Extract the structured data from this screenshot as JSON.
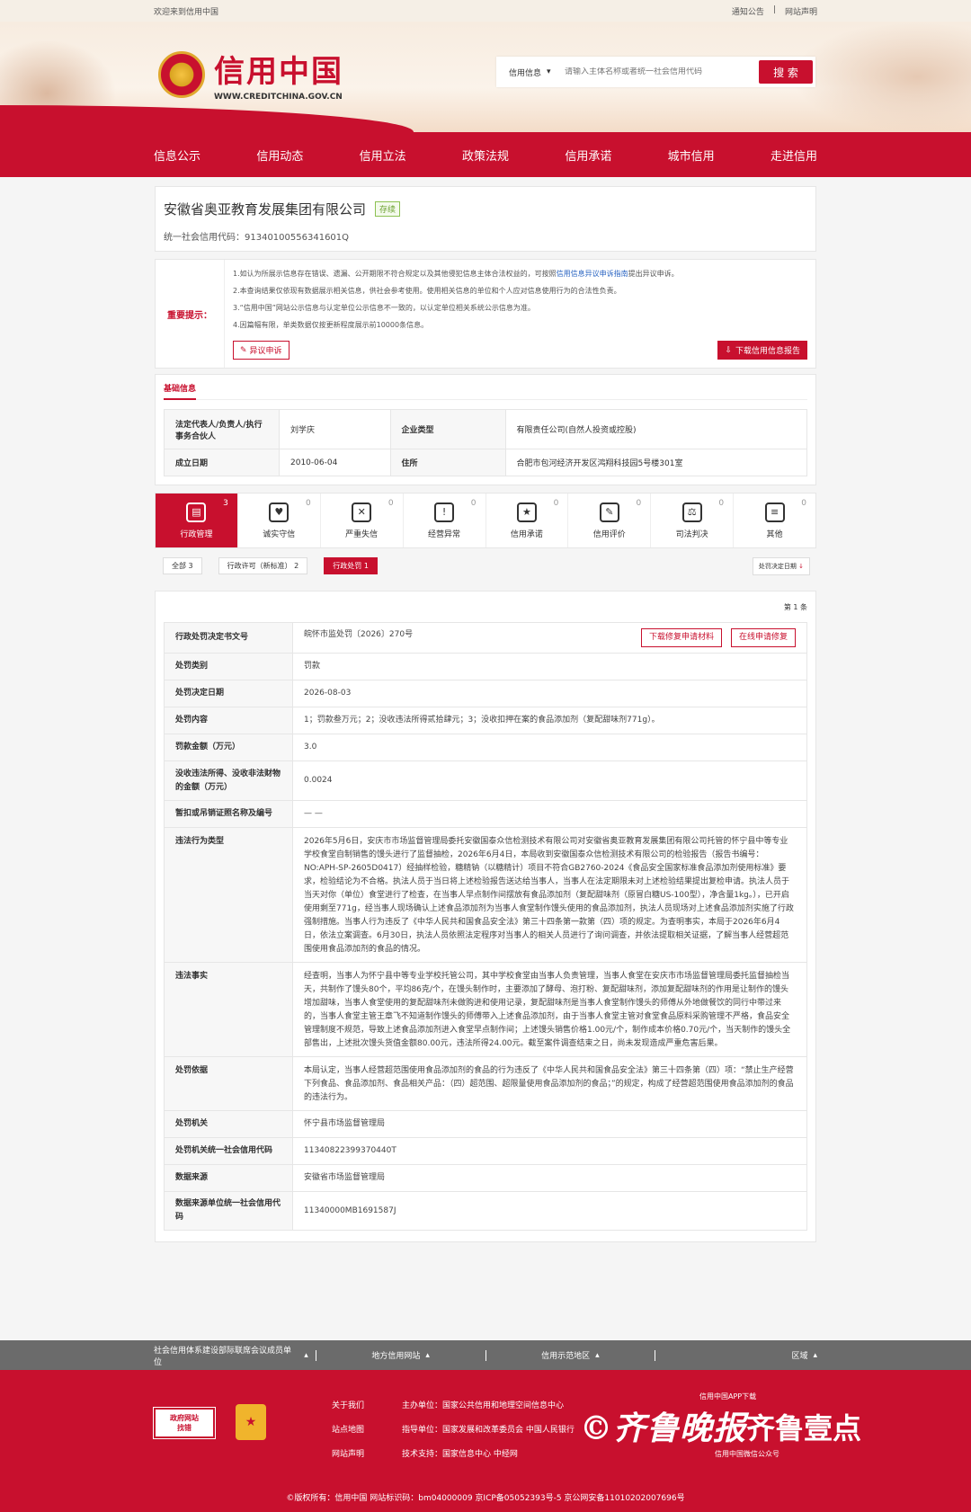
{
  "topbar": {
    "welcome": "欢迎来到信用中国",
    "notice": "通知公告",
    "sep": "|",
    "statement": "网站声明"
  },
  "header": {
    "title": "信用中国",
    "url": "WWW.CREDITCHINA.GOV.CN"
  },
  "search": {
    "select": "信用信息",
    "placeholder": "请输入主体名称或者统一社会信用代码",
    "button": "搜 索"
  },
  "nav": [
    "信息公示",
    "信用动态",
    "信用立法",
    "政策法规",
    "信用承诺",
    "城市信用",
    "走进信用"
  ],
  "company": {
    "name": "安徽省奥亚教育发展集团有限公司",
    "status": "存续",
    "code_label": "统一社会信用代码：",
    "code": "91340100556341601Q"
  },
  "notice": {
    "label": "重要提示：",
    "lines": [
      "1.如认为所展示信息存在错误、遗漏、公开期限不符合规定以及其他侵犯信息主体合法权益的，可按照",
      "2.本查询结果仅依现有数据展示相关信息，供社会参考使用。使用相关信息的单位和个人应对信息使用行为的合法性负责。",
      "3.“信用中国”网站公示信息与认定单位公示信息不一致的，以认定单位相关系统公示信息为准。",
      "4.因篇幅有限，单类数据仅按更新程度展示前10000条信息。"
    ],
    "line1_link": "信用信息异议申诉指南",
    "line1_tail": "提出异议申诉。",
    "objection": "异议申诉",
    "download": "下载信用信息报告"
  },
  "basic": {
    "title": "基础信息",
    "rows": [
      {
        "k1": "法定代表人/负责人/执行事务合伙人",
        "v1": "刘学庆",
        "k2": "企业类型",
        "v2": "有限责任公司(自然人投资或控股)"
      },
      {
        "k1": "成立日期",
        "v1": "2010-06-04",
        "k2": "住所",
        "v2": "合肥市包河经济开发区鸿翔科技园5号楼301室"
      }
    ]
  },
  "tabs": [
    {
      "label": "行政管理",
      "count": "3",
      "icon": "▤"
    },
    {
      "label": "诚实守信",
      "count": "0",
      "icon": "♥"
    },
    {
      "label": "严重失信",
      "count": "0",
      "icon": "✕"
    },
    {
      "label": "经营异常",
      "count": "0",
      "icon": "!"
    },
    {
      "label": "信用承诺",
      "count": "0",
      "icon": "★"
    },
    {
      "label": "信用评价",
      "count": "0",
      "icon": "✎"
    },
    {
      "label": "司法判决",
      "count": "0",
      "icon": "⚖"
    },
    {
      "label": "其他",
      "count": "0",
      "icon": "≡"
    }
  ],
  "filters": {
    "all": "全部  3",
    "license": "行政许可（新标准）  2",
    "penalty": "行政处罚  1",
    "sort": "处罚决定日期"
  },
  "detail": {
    "page_count": "第 1 条",
    "btn_download": "下载修复申请材料",
    "btn_online": "在线申请修复",
    "rows": [
      {
        "k": "行政处罚决定书文号",
        "v": "皖怀市监处罚〔2026〕270号"
      },
      {
        "k": "处罚类别",
        "v": "罚款"
      },
      {
        "k": "处罚决定日期",
        "v": "2026-08-03"
      },
      {
        "k": "处罚内容",
        "v": "1；罚款叁万元；2；没收违法所得贰拾肆元；3；没收扣押在案的食品添加剂（复配甜味剂771g）。"
      },
      {
        "k": "罚款金额（万元）",
        "v": "3.0"
      },
      {
        "k": "没收违法所得、没收非法财物的金额（万元）",
        "v": "0.0024"
      },
      {
        "k": "暂扣或吊销证照名称及编号",
        "v": "— —"
      },
      {
        "k": "违法行为类型",
        "v": "2026年5月6日，安庆市市场监督管理局委托安徽国泰众信检测技术有限公司对安徽省奥亚教育发展集团有限公司托管的怀宁县中等专业学校食堂自制销售的馒头进行了监督抽检，2026年6月4日，本局收到安徽国泰众信检测技术有限公司的检验报告（报告书编号：NO:APH-SP-2605D0417）经抽样检验，糖精钠（以糖精计）项目不符合GB2760-2024《食品安全国家标准食品添加剂使用标准》要求，检验结论为不合格。执法人员于当日将上述检验报告送达给当事人，当事人在法定期限未对上述检验结果提出复检申请。执法人员于当天对你（单位）食堂进行了检查，在当事人早点制作间摆放有食品添加剂（复配甜味剂（原冒白糖US-100型），净含量1kg。），已开启使用剩至771g，经当事人现场确认上述食品添加剂为当事人食堂制作馒头使用的食品添加剂，执法人员现场对上述食品添加剂实施了行政强制措施。当事人行为违反了《中华人民共和国食品安全法》第三十四条第一款第（四）项的规定。为查明事实，本局于2026年6月4日，依法立案调查。6月30日，执法人员依照法定程序对当事人的相关人员进行了询问调查，并依法提取相关证据，了解当事人经营超范围使用食品添加剂的食品的情况。"
      },
      {
        "k": "违法事实",
        "v": "经查明，当事人为怀宁县中等专业学校托管公司，其中学校食堂由当事人负责管理，当事人食堂在安庆市市场监督管理局委托监督抽检当天，共制作了馒头80个，平均86克/个，在馒头制作时，主要添加了酵母、泡打粉、复配甜味剂，添加复配甜味剂的作用是让制作的馒头增加甜味，当事人食堂使用的复配甜味剂未做购进和使用记录，复配甜味剂是当事人食堂制作馒头的师傅从外地做餐饮的同行中带过来的，当事人食堂主管王章飞不知道制作馒头的师傅带入上述食品添加剂，由于当事人食堂主管对食堂食品原料采购管理不严格，食品安全管理制度不规范，导致上述食品添加剂进入食堂早点制作间；上述馒头销售价格1.00元/个，制作成本价格0.70元/个，当天制作的馒头全部售出，上述批次馒头货值金额80.00元，违法所得24.00元。截至案件调查结束之日，尚未发现造成严重危害后果。"
      },
      {
        "k": "处罚依据",
        "v": "本局认定，当事人经营超范围使用食品添加剂的食品的行为违反了《中华人民共和国食品安全法》第三十四条第（四）项：“禁止生产经营下列食品、食品添加剂、食品相关产品：（四）超范围、超限量使用食品添加剂的食品；”的规定，构成了经营超范围使用食品添加剂的食品的违法行为。"
      },
      {
        "k": "处罚机关",
        "v": "怀宁县市场监督管理局"
      },
      {
        "k": "处罚机关统一社会信用代码",
        "v": "11340822399370440T"
      },
      {
        "k": "数据来源",
        "v": "安徽省市场监督管理局"
      },
      {
        "k": "数据来源单位统一社会信用代码",
        "v": "11340000MB1691587J"
      }
    ]
  },
  "footbar": [
    "社会信用体系建设部际联席会议成员单位",
    "地方信用网站",
    "信用示范地区",
    "区域"
  ],
  "footer": {
    "gov_l1": "政府网站",
    "gov_l2": "找错",
    "links": [
      "关于我们",
      "站点地图",
      "网站声明"
    ],
    "info": [
      "主办单位：国家公共信用和地理空间信息中心",
      "指导单位：国家发展和改革委员会 中国人民银行",
      "技术支持：国家信息中心 中经网"
    ],
    "app": "信用中国APP下载",
    "wechat": "信用中国微信公众号",
    "watermark1": "©齐鲁晚报",
    "watermark2": "齐鲁壹点",
    "copyright": "©版权所有：信用中国    网站标识码：bm04000009    京ICP备05052393号-5    京公网安备11010202007696号"
  }
}
